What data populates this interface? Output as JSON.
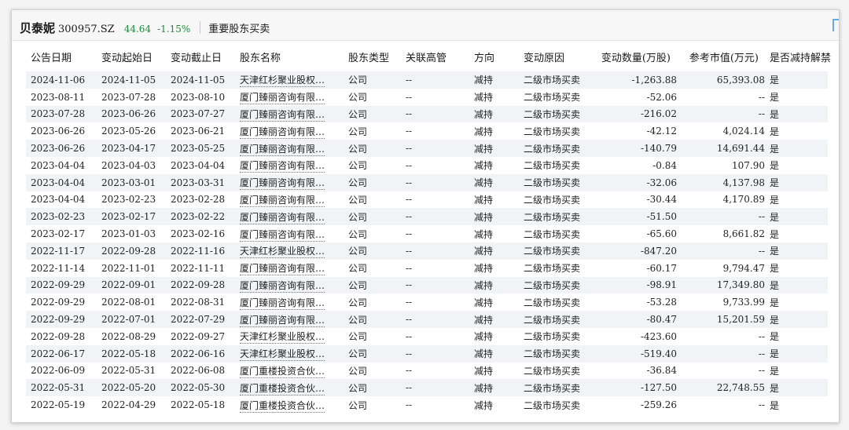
{
  "header": {
    "stock_name": "贝泰妮",
    "stock_code": "300957.SZ",
    "price": "44.64",
    "change_pct": "-1.15%",
    "section_title": "重要股东买卖"
  },
  "columns": [
    "公告日期",
    "变动起始日",
    "变动截止日",
    "股东名称",
    "股东类型",
    "关联高管",
    "方向",
    "变动原因",
    "变动数量(万股)",
    "参考市值(万元)",
    "是否减持解禁"
  ],
  "rows": [
    [
      "2024-11-06",
      "2024-11-05",
      "2024-11-05",
      "天津红杉聚业股权…",
      "公司",
      "--",
      "减持",
      "二级市场买卖",
      "-1,263.88",
      "65,393.08",
      "是"
    ],
    [
      "2023-08-11",
      "2023-07-28",
      "2023-08-10",
      "厦门臻丽咨询有限…",
      "公司",
      "--",
      "减持",
      "二级市场买卖",
      "-52.06",
      "--",
      "是"
    ],
    [
      "2023-07-28",
      "2023-06-26",
      "2023-07-27",
      "厦门臻丽咨询有限…",
      "公司",
      "--",
      "减持",
      "二级市场买卖",
      "-216.02",
      "--",
      "是"
    ],
    [
      "2023-06-26",
      "2023-05-26",
      "2023-06-21",
      "厦门臻丽咨询有限…",
      "公司",
      "--",
      "减持",
      "二级市场买卖",
      "-42.12",
      "4,024.14",
      "是"
    ],
    [
      "2023-06-26",
      "2023-04-17",
      "2023-05-25",
      "厦门臻丽咨询有限…",
      "公司",
      "--",
      "减持",
      "二级市场买卖",
      "-140.79",
      "14,691.44",
      "是"
    ],
    [
      "2023-04-04",
      "2023-04-03",
      "2023-04-04",
      "厦门臻丽咨询有限…",
      "公司",
      "--",
      "减持",
      "二级市场买卖",
      "-0.84",
      "107.90",
      "是"
    ],
    [
      "2023-04-04",
      "2023-03-01",
      "2023-03-31",
      "厦门臻丽咨询有限…",
      "公司",
      "--",
      "减持",
      "二级市场买卖",
      "-32.06",
      "4,137.98",
      "是"
    ],
    [
      "2023-04-04",
      "2023-02-23",
      "2023-02-28",
      "厦门臻丽咨询有限…",
      "公司",
      "--",
      "减持",
      "二级市场买卖",
      "-30.44",
      "4,170.89",
      "是"
    ],
    [
      "2023-02-23",
      "2023-02-17",
      "2023-02-22",
      "厦门臻丽咨询有限…",
      "公司",
      "--",
      "减持",
      "二级市场买卖",
      "-51.50",
      "--",
      "是"
    ],
    [
      "2023-02-17",
      "2023-01-03",
      "2023-02-16",
      "厦门臻丽咨询有限…",
      "公司",
      "--",
      "减持",
      "二级市场买卖",
      "-65.60",
      "8,661.82",
      "是"
    ],
    [
      "2022-11-17",
      "2022-09-28",
      "2022-11-16",
      "天津红杉聚业股权…",
      "公司",
      "--",
      "减持",
      "二级市场买卖",
      "-847.20",
      "--",
      "是"
    ],
    [
      "2022-11-14",
      "2022-11-01",
      "2022-11-11",
      "厦门臻丽咨询有限…",
      "公司",
      "--",
      "减持",
      "二级市场买卖",
      "-60.17",
      "9,794.47",
      "是"
    ],
    [
      "2022-09-29",
      "2022-09-01",
      "2022-09-28",
      "厦门臻丽咨询有限…",
      "公司",
      "--",
      "减持",
      "二级市场买卖",
      "-98.91",
      "17,349.80",
      "是"
    ],
    [
      "2022-09-29",
      "2022-08-01",
      "2022-08-31",
      "厦门臻丽咨询有限…",
      "公司",
      "--",
      "减持",
      "二级市场买卖",
      "-53.28",
      "9,733.99",
      "是"
    ],
    [
      "2022-09-29",
      "2022-07-01",
      "2022-07-29",
      "厦门臻丽咨询有限…",
      "公司",
      "--",
      "减持",
      "二级市场买卖",
      "-80.47",
      "15,201.59",
      "是"
    ],
    [
      "2022-09-28",
      "2022-08-29",
      "2022-09-27",
      "天津红杉聚业股权…",
      "公司",
      "--",
      "减持",
      "二级市场买卖",
      "-423.60",
      "--",
      "是"
    ],
    [
      "2022-06-17",
      "2022-05-18",
      "2022-06-16",
      "天津红杉聚业股权…",
      "公司",
      "--",
      "减持",
      "二级市场买卖",
      "-519.40",
      "--",
      "是"
    ],
    [
      "2022-06-09",
      "2022-05-31",
      "2022-06-08",
      "厦门重楼投资合伙…",
      "公司",
      "--",
      "减持",
      "二级市场买卖",
      "-36.84",
      "--",
      "是"
    ],
    [
      "2022-05-31",
      "2022-05-20",
      "2022-05-30",
      "厦门重楼投资合伙…",
      "公司",
      "--",
      "减持",
      "二级市场买卖",
      "-127.50",
      "22,748.55",
      "是"
    ],
    [
      "2022-05-19",
      "2022-04-29",
      "2022-05-18",
      "厦门重楼投资合伙…",
      "公司",
      "--",
      "减持",
      "二级市场买卖",
      "-259.26",
      "--",
      "是"
    ]
  ],
  "colors": {
    "up_down_green": "#2f9a4c",
    "stripe": "#f1f3f6"
  }
}
